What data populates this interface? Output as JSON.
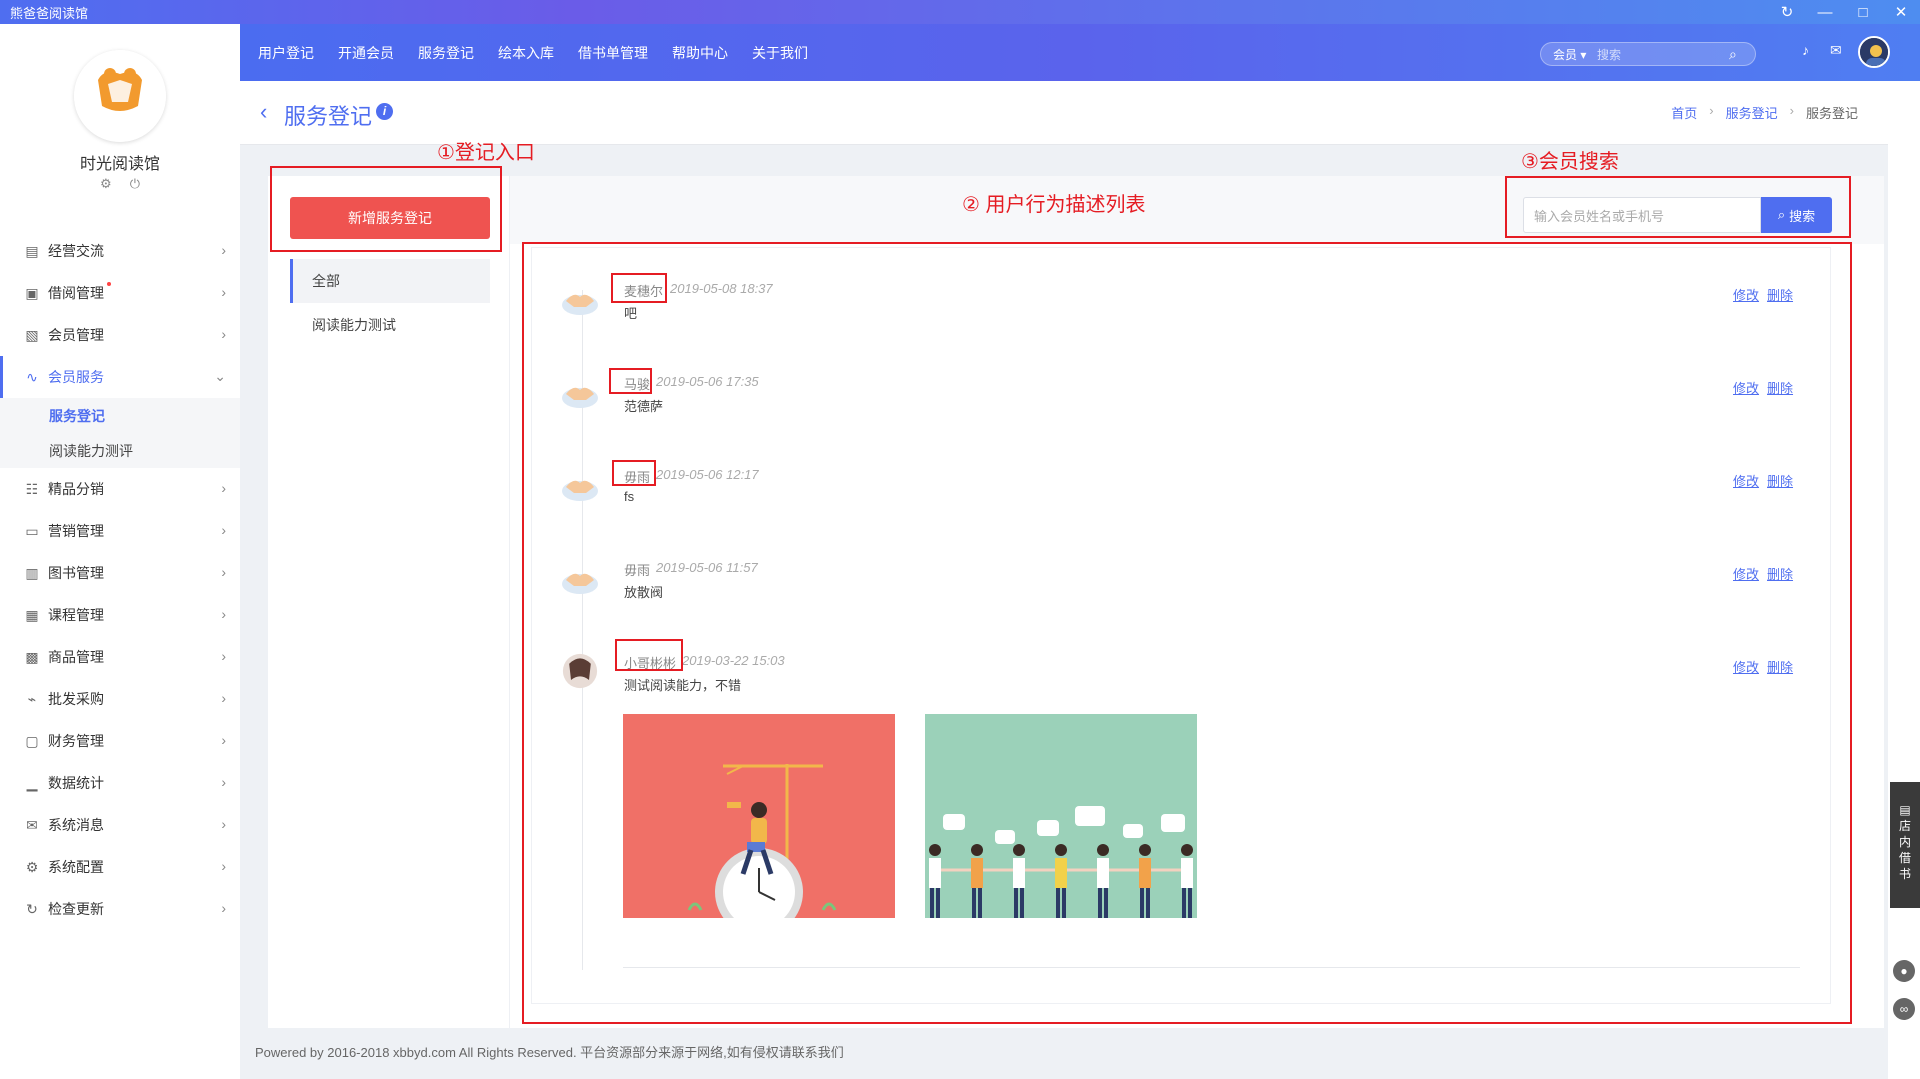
{
  "window": {
    "title": "熊爸爸阅读馆",
    "refresh_icon": "refresh-icon",
    "min_icon": "minimize-icon",
    "max_icon": "maximize-icon",
    "close_icon": "close-icon"
  },
  "shop": {
    "name": "时光阅读馆",
    "logo_text": "熊爸爸阅读馆",
    "settings_icon": "gear-icon",
    "power_icon": "power-icon"
  },
  "sidebar": {
    "items": [
      {
        "label": "经营交流",
        "icon": "chat-icon"
      },
      {
        "label": "借阅管理",
        "icon": "book-hand-icon"
      },
      {
        "label": "会员管理",
        "icon": "member-card-icon"
      },
      {
        "label": "会员服务",
        "icon": "pulse-icon"
      },
      {
        "label": "精品分销",
        "icon": "org-tree-icon"
      },
      {
        "label": "营销管理",
        "icon": "ticket-icon"
      },
      {
        "label": "图书管理",
        "icon": "book-icon"
      },
      {
        "label": "课程管理",
        "icon": "course-icon"
      },
      {
        "label": "商品管理",
        "icon": "bag-icon"
      },
      {
        "label": "批发采购",
        "icon": "cart-icon"
      },
      {
        "label": "财务管理",
        "icon": "finance-icon"
      },
      {
        "label": "数据统计",
        "icon": "bar-chart-icon"
      },
      {
        "label": "系统消息",
        "icon": "mail-icon"
      },
      {
        "label": "系统配置",
        "icon": "gear-icon"
      },
      {
        "label": "检查更新",
        "icon": "sync-icon"
      }
    ],
    "sub_items": [
      {
        "label": "服务登记"
      },
      {
        "label": "阅读能力测评"
      }
    ]
  },
  "topnav": {
    "items": [
      "用户登记",
      "开通会员",
      "服务登记",
      "绘本入库",
      "借书单管理",
      "帮助中心",
      "关于我们"
    ],
    "search_select": "会员",
    "search_placeholder": "搜索"
  },
  "header": {
    "title": "服务登记",
    "breadcrumb": [
      "首页",
      "服务登记",
      "服务登记"
    ]
  },
  "left_panel": {
    "add_button": "新增服务登记",
    "filters": [
      "全部",
      "阅读能力测试"
    ]
  },
  "member_search": {
    "placeholder": "输入会员姓名或手机号",
    "button": "搜索"
  },
  "entries": [
    {
      "name": "麦穗尔",
      "time": "2019-05-08 18:37",
      "desc": "吧"
    },
    {
      "name": "马骏",
      "time": "2019-05-06 17:35",
      "desc": "范德萨"
    },
    {
      "name": "毋雨",
      "time": "2019-05-06 12:17",
      "desc": "fs"
    },
    {
      "name": "毋雨",
      "time": "2019-05-06 11:57",
      "desc": "放散阀"
    },
    {
      "name": "小哥彬彬",
      "time": "2019-03-22 15:03",
      "desc": "测试阅读能力，不错"
    }
  ],
  "entry_actions": {
    "edit": "修改",
    "delete": "删除"
  },
  "annotations": {
    "a1": "①登记入口",
    "a2": "② 用户行为描述列表",
    "a3": "③会员搜索"
  },
  "right_rail": {
    "tab_chars": [
      "店",
      "内",
      "借",
      "书"
    ]
  },
  "footer": "Powered by 2016-2018 xbbyd.com All Rights Reserved. 平台资源部分来源于网络,如有侵权请联系我们",
  "colors": {
    "accent": "#4f6ef0",
    "danger": "#ef5350",
    "annotation": "#e51c23"
  }
}
